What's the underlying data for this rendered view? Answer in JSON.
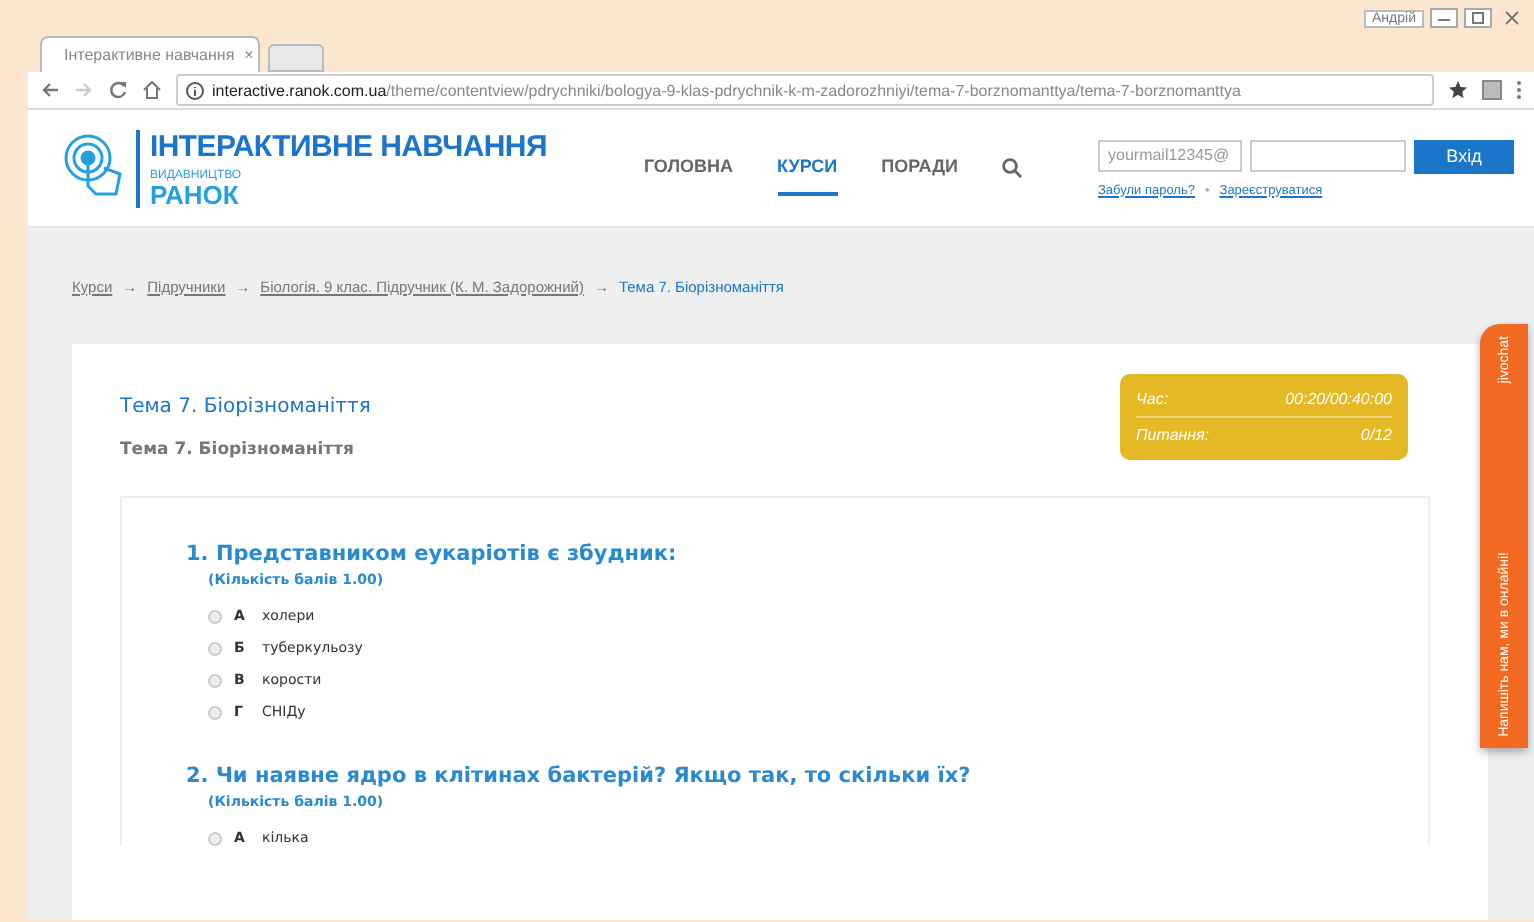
{
  "browser": {
    "tab_title": "Інтерактивне навчання",
    "tab_close": "×",
    "user": "Андрій",
    "url_host": "interactive.ranok.com.ua",
    "url_path": "/theme/contentview/pdrychniki/bologya-9-klas-pdrychnik-k-m-zadorozhniyi/tema-7-borznomanttya/tema-7-borznomanttya"
  },
  "site": {
    "logo_title": "ІНТЕРАКТИВНЕ НАВЧАННЯ",
    "logo_sub": "ВИДАВНИЦТВО",
    "logo_brand": "РАНОК",
    "nav": [
      {
        "label": "ГОЛОВНА",
        "selected": false
      },
      {
        "label": "КУРСИ",
        "selected": true
      },
      {
        "label": "ПОРАДИ",
        "selected": false
      }
    ],
    "email_placeholder": "yourmail12345@",
    "login_button": "Вхід",
    "forgot": "Забули пароль?",
    "separator": "•",
    "register": "Зареєструватися"
  },
  "breadcrumbs": [
    {
      "label": "Курси",
      "link": true,
      "arrow": "→"
    },
    {
      "label": "Підручники",
      "link": true,
      "arrow": "→"
    },
    {
      "label": "Біологія. 9 клас. Підручник (К. М. Задорожний)",
      "link": true,
      "arrow": "→"
    },
    {
      "label": "Тема 7. Біорізноманіття",
      "link": false
    }
  ],
  "test": {
    "title": "Тема 7. Біорізноманіття",
    "subtitle": "Тема 7. Біорізноманіття",
    "timer": [
      {
        "label": "Час:",
        "value": "00:20/00:40:00"
      },
      {
        "label": "Питання:",
        "value": "0/12"
      }
    ],
    "questions": [
      {
        "number": "1.",
        "text": "Представником еукаріотів є збудник:",
        "points": "(Кількість балів 1.00)",
        "options": [
          {
            "letter": "А",
            "text": "холери",
            "selected": false
          },
          {
            "letter": "Б",
            "text": "туберкульозу",
            "selected": false
          },
          {
            "letter": "В",
            "text": "корости",
            "selected": false
          },
          {
            "letter": "Г",
            "text": "СНІДу",
            "selected": false
          }
        ]
      },
      {
        "number": "2.",
        "text": "Чи наявне ядро в клітинах бактерій? Якщо так, то скільки їх?",
        "points": "(Кількість балів 1.00)",
        "options": [
          {
            "letter": "А",
            "text": "кілька",
            "selected": false
          }
        ]
      }
    ]
  },
  "chat": {
    "label": "Напишіть нам, ми в онлайні!",
    "brand": "jivochat"
  }
}
